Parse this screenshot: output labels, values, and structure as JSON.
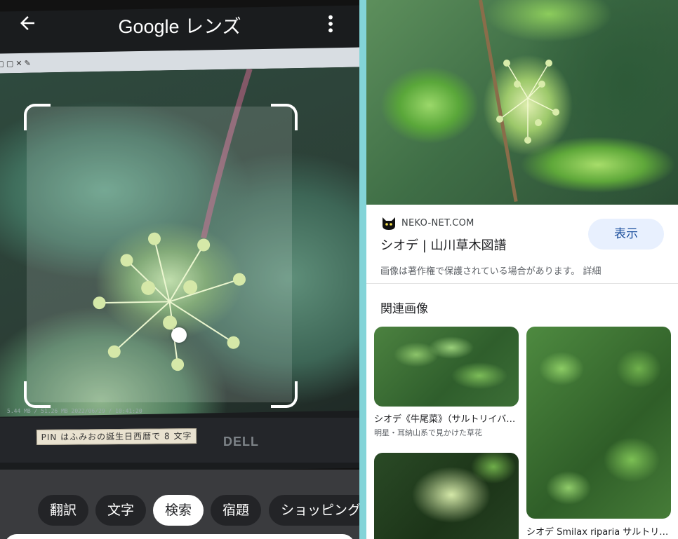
{
  "lens": {
    "title": "Google レンズ",
    "back_icon": "arrow-back-icon",
    "menu_icon": "more-vert-icon",
    "monitor_sticker": "PIN はふみおの誕生日西暦で 8 文字",
    "monitor_brand": "DELL",
    "monitor_status": "5.44 MB / 51.26 MB  2022/06/29 / 10:41:20",
    "modes": [
      {
        "label": "翻訳",
        "active": false
      },
      {
        "label": "文字",
        "active": false
      },
      {
        "label": "検索",
        "active": true
      },
      {
        "label": "宿題",
        "active": false
      },
      {
        "label": "ショッピング",
        "active": false
      }
    ]
  },
  "result": {
    "site": "NEKO-NET.COM",
    "site_icon": "cat-favicon-icon",
    "title": "シオデ | 山川草木図譜",
    "view_button": "表示",
    "copyright_notice": "画像は著作権で保護されている場合があります。 詳細"
  },
  "related": {
    "heading": "関連画像",
    "items": [
      {
        "caption": "シオデ《牛尾菜》（サルトリイバラ科）",
        "subcaption": "明星・耳納山系で見かけた草花"
      },
      {
        "caption": "シオデ Smilax riparia サルトリイバラ",
        "subcaption": ""
      },
      {
        "caption": "",
        "subcaption": ""
      }
    ]
  },
  "colors": {
    "accent_button_bg": "#e8f0fe",
    "accent_button_text": "#1a4e9c",
    "divider": "#83d4d8"
  }
}
